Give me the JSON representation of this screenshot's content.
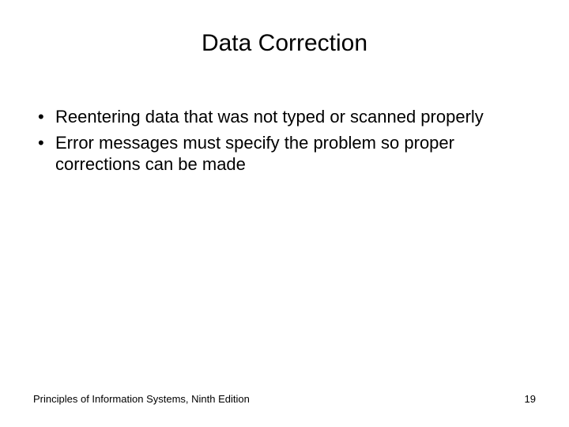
{
  "slide": {
    "title": "Data Correction",
    "bullets": [
      "Reentering data that was not typed or scanned properly",
      "Error messages must specify the problem so proper corrections can be made"
    ],
    "footer_left": "Principles of Information Systems, Ninth Edition",
    "page_number": "19"
  }
}
